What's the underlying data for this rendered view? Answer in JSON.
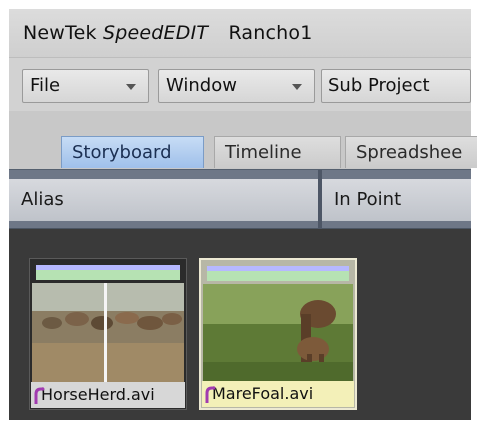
{
  "window": {
    "brand": "NewTek",
    "product": "SpeedEDIT",
    "project": "Rancho1"
  },
  "menubar": {
    "items": [
      {
        "label": "File",
        "has_dropdown": true
      },
      {
        "label": "Window",
        "has_dropdown": true
      },
      {
        "label": "Sub Project",
        "has_dropdown": false
      }
    ]
  },
  "tabs": [
    {
      "label": "Storyboard",
      "active": true
    },
    {
      "label": "Timeline",
      "active": false
    },
    {
      "label": "Spreadshee",
      "active": false
    }
  ],
  "columns": {
    "alias": "Alias",
    "in_point": "In Point"
  },
  "clips": [
    {
      "label": "HorseHerd.avi",
      "selected": false,
      "icon": "link-icon"
    },
    {
      "label": "MareFoal.avi",
      "selected": true,
      "icon": "link-icon"
    }
  ],
  "colors": {
    "active_tab": "#a9c7ee",
    "selected_label": "#f3f0b8",
    "board_bg": "#3a3a3a",
    "clip_bar": "#b6e2b3"
  }
}
